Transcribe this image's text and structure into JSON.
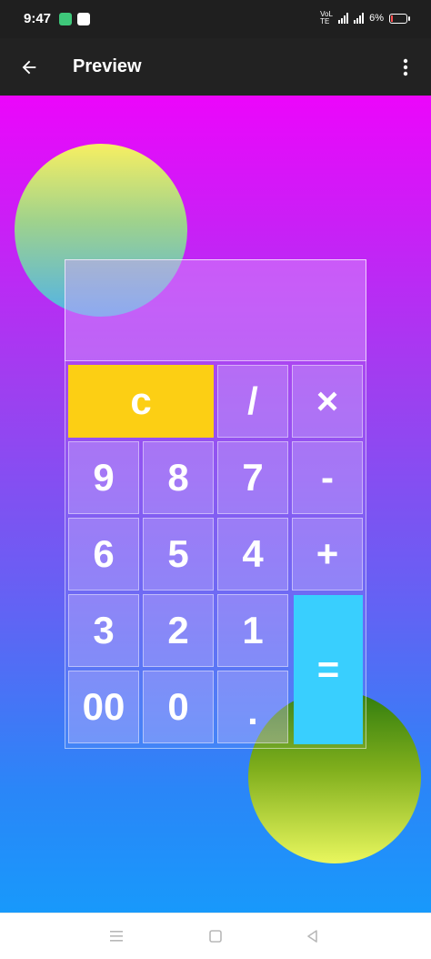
{
  "status_bar": {
    "time": "9:47",
    "battery": "6%",
    "network": "VoLTE"
  },
  "toolbar": {
    "title": "Preview",
    "back_icon": "arrow-left-icon",
    "more_icon": "more-vertical-icon"
  },
  "calculator": {
    "display": "",
    "keys": {
      "clear": "c",
      "divide": "/",
      "multiply": "×",
      "nine": "9",
      "eight": "8",
      "seven": "7",
      "minus": "-",
      "six": "6",
      "five": "5",
      "four": "4",
      "plus": "+",
      "three": "3",
      "two": "2",
      "one": "1",
      "equals": "=",
      "double_zero": "00",
      "zero": "0",
      "decimal": "."
    },
    "colors": {
      "clear_key": "#fccf14",
      "equals_key": "#39cffe",
      "background_top": "#ec06fb",
      "background_bottom": "#1899fb"
    }
  },
  "nav_bar": {
    "menu_icon": "menu-icon",
    "home_icon": "home-square-icon",
    "back_icon": "back-triangle-icon"
  }
}
